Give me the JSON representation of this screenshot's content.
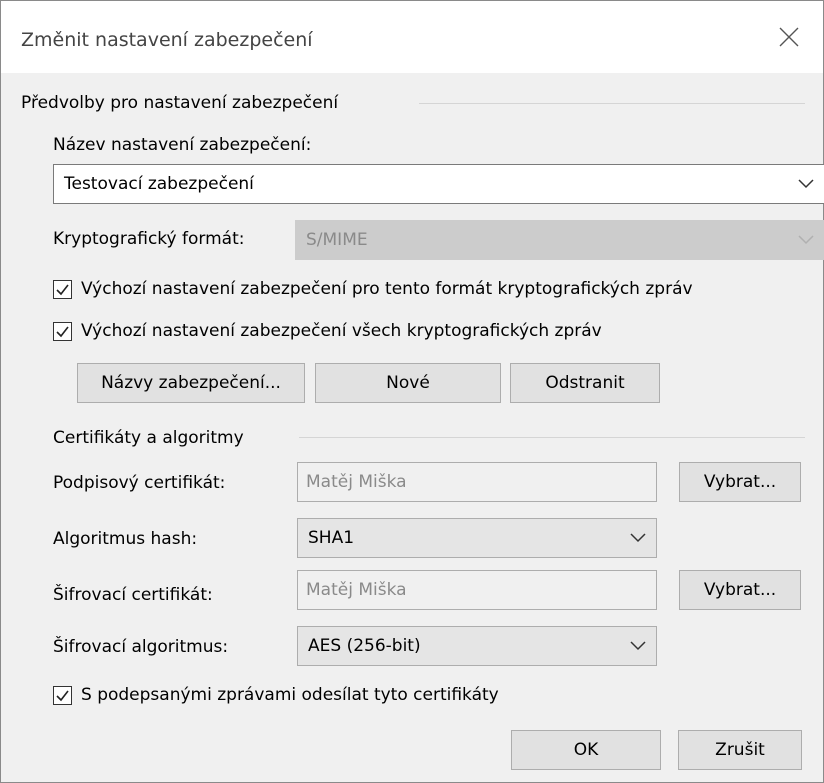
{
  "dialog": {
    "title": "Změnit nastavení zabezpečení",
    "close_icon": "close-icon"
  },
  "prefs": {
    "group_label": "Předvolby pro nastavení zabezpečení",
    "name_label": "Název nastavení zabezpečení:",
    "name_value": "Testovací zabezpečení",
    "crypto_label": "Kryptografický formát:",
    "crypto_value": "S/MIME",
    "default_format_label": "Výchozí nastavení zabezpečení pro tento formát kryptografických zpráv",
    "default_format_checked": true,
    "default_all_label": "Výchozí nastavení zabezpečení všech kryptografických zpráv",
    "default_all_checked": true,
    "security_names_button": "Názvy zabezpečení...",
    "new_button": "Nové",
    "remove_button": "Odstranit"
  },
  "certs": {
    "group_label": "Certifikáty a algoritmy",
    "signing_cert_label": "Podpisový certifikát:",
    "signing_cert_value": "Matěj Miška",
    "choose_button_1": "Vybrat...",
    "hash_label": "Algoritmus hash:",
    "hash_value": "SHA1",
    "enc_cert_label": "Šifrovací certifikát:",
    "enc_cert_value": "Matěj Miška",
    "choose_button_2": "Vybrat...",
    "enc_alg_label": "Šifrovací algoritmus:",
    "enc_alg_value": "AES (256-bit)",
    "send_certs_label": "S podepsanými zprávami odesílat tyto certifikáty",
    "send_certs_checked": true
  },
  "footer": {
    "ok_button": "OK",
    "cancel_button": "Zrušit"
  }
}
